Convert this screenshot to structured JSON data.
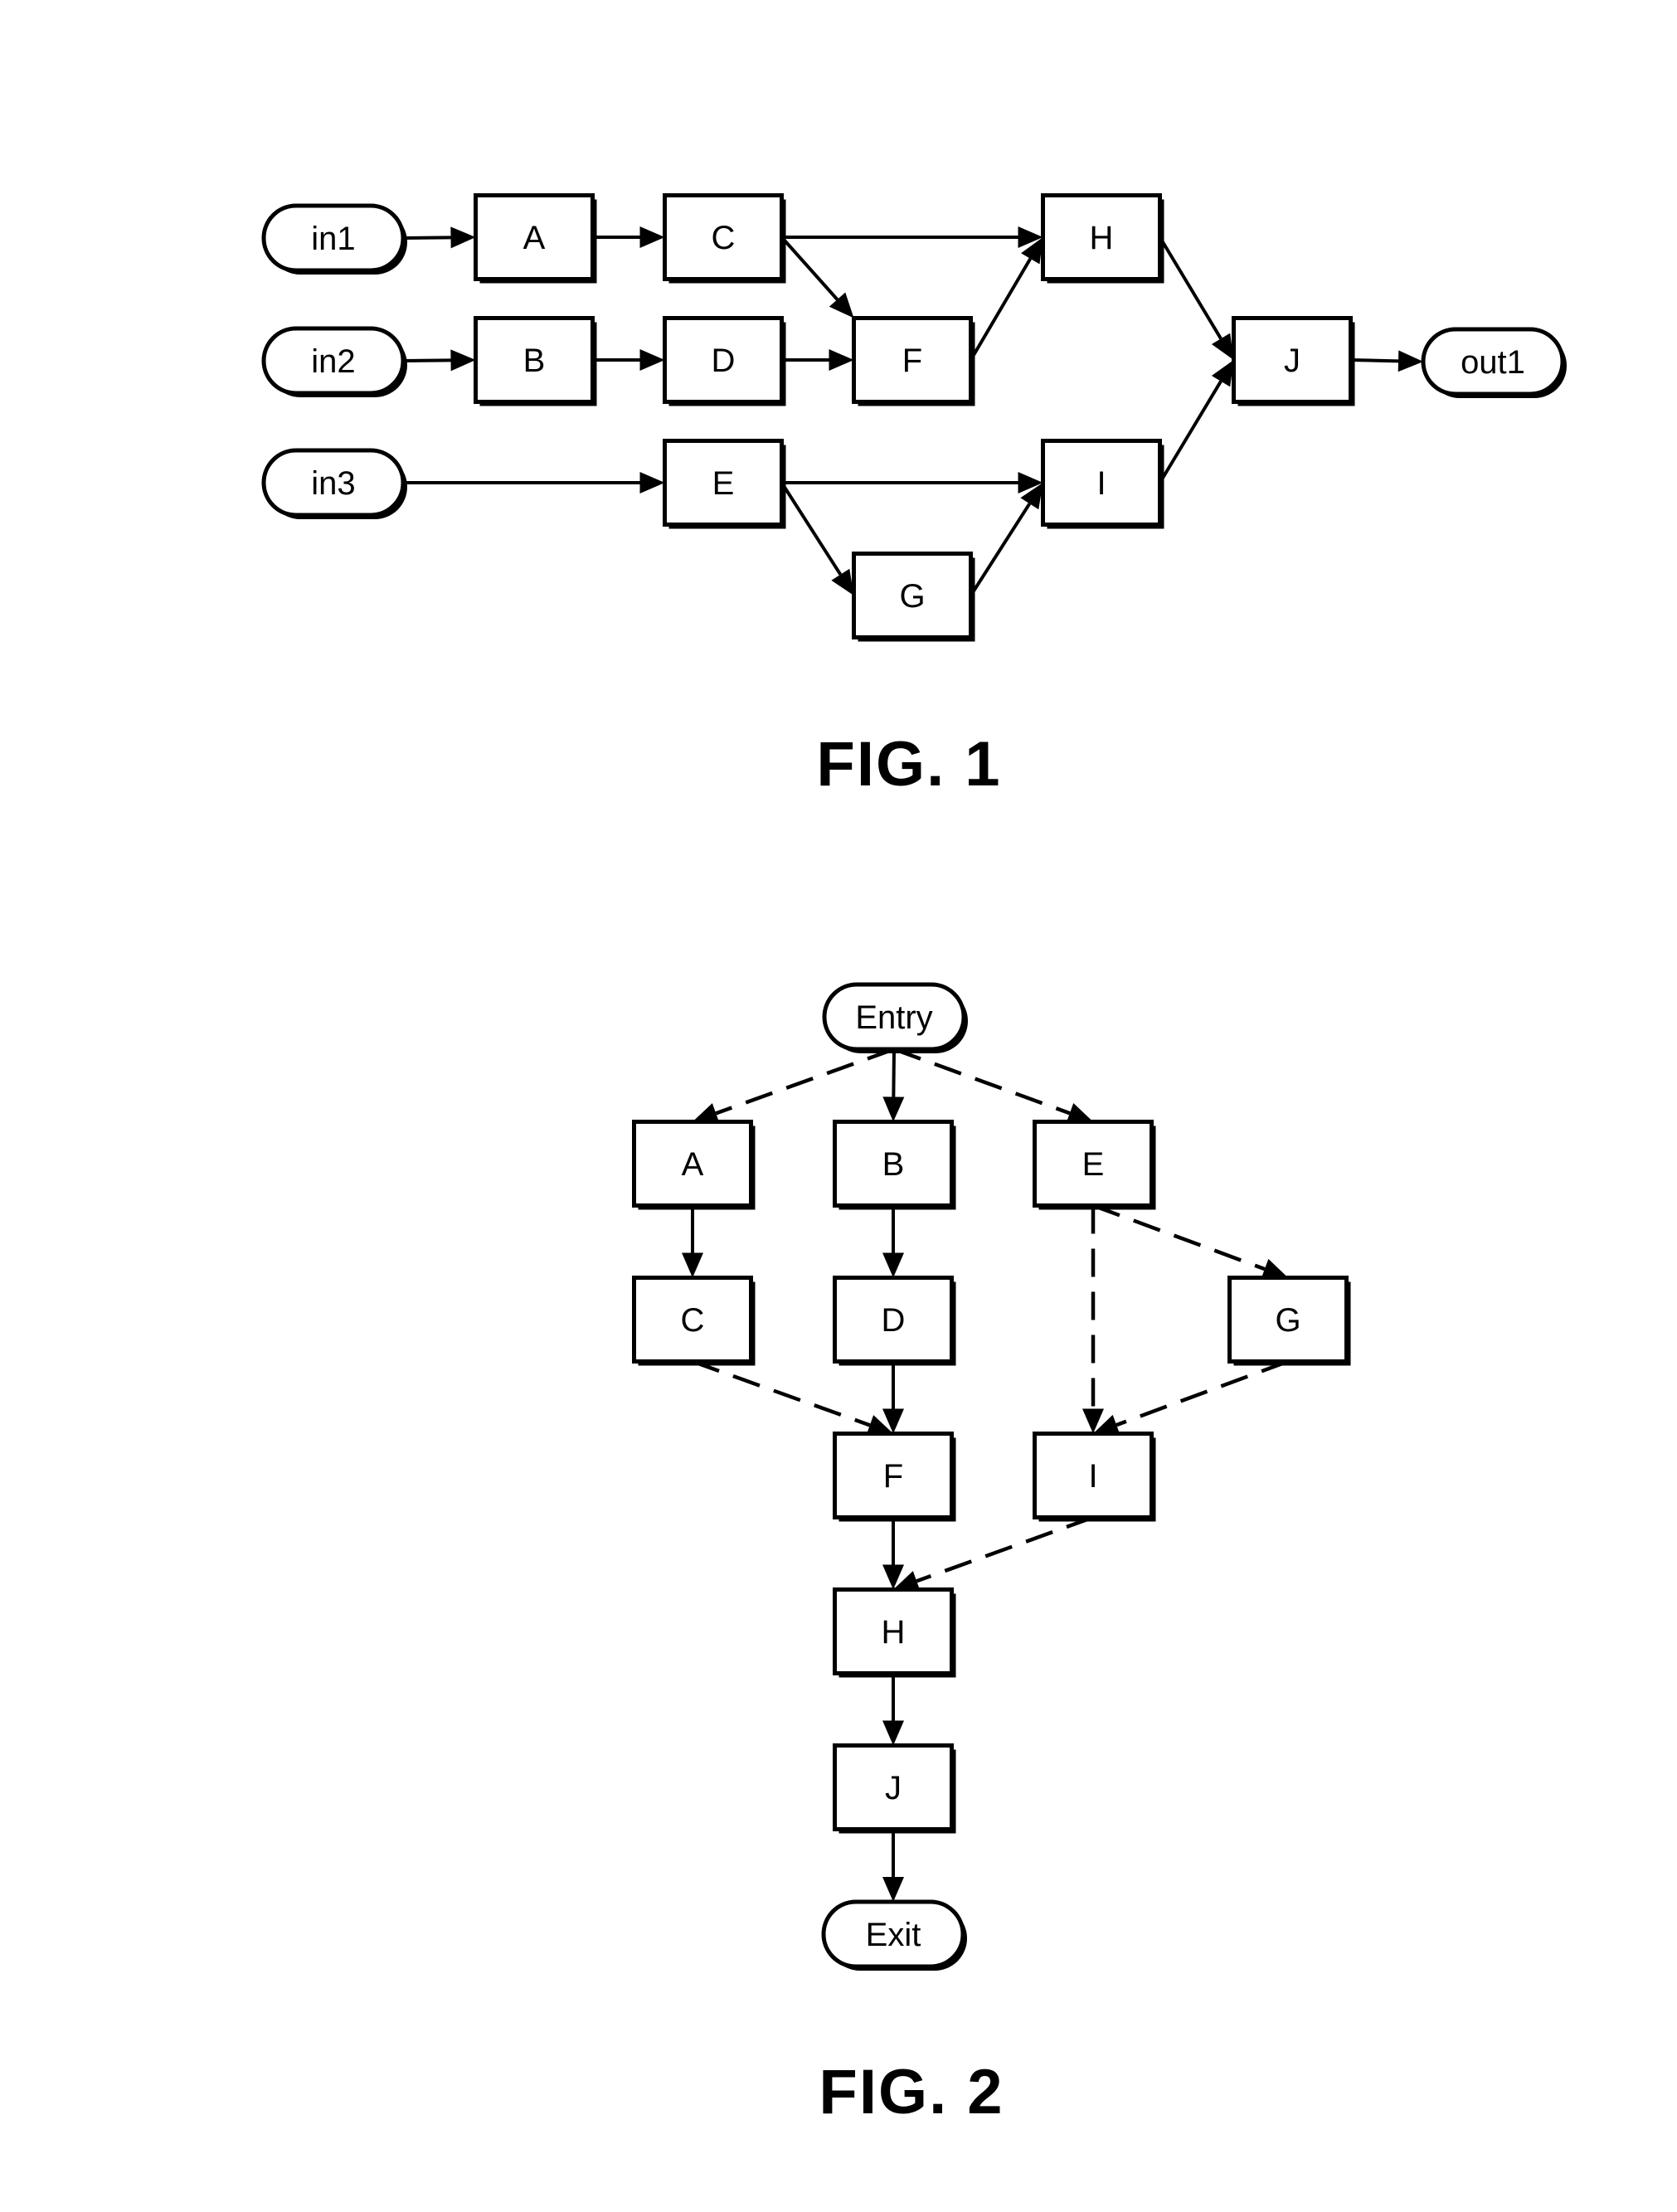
{
  "document": {
    "type": "patent-drawing-sheet",
    "background_color": "#ffffff",
    "ink_color": "#000000"
  },
  "figures": [
    {
      "id": "fig1",
      "caption": "FIG. 1",
      "description": "Block dataflow diagram",
      "nodes": [
        {
          "id": "in1",
          "label": "in1",
          "shape": "terminal"
        },
        {
          "id": "in2",
          "label": "in2",
          "shape": "terminal"
        },
        {
          "id": "in3",
          "label": "in3",
          "shape": "terminal"
        },
        {
          "id": "A",
          "label": "A",
          "shape": "block"
        },
        {
          "id": "B",
          "label": "B",
          "shape": "block"
        },
        {
          "id": "C",
          "label": "C",
          "shape": "block"
        },
        {
          "id": "D",
          "label": "D",
          "shape": "block"
        },
        {
          "id": "E",
          "label": "E",
          "shape": "block"
        },
        {
          "id": "F",
          "label": "F",
          "shape": "block"
        },
        {
          "id": "G",
          "label": "G",
          "shape": "block"
        },
        {
          "id": "H",
          "label": "H",
          "shape": "block"
        },
        {
          "id": "I",
          "label": "I",
          "shape": "block"
        },
        {
          "id": "J",
          "label": "J",
          "shape": "block"
        },
        {
          "id": "out1",
          "label": "out1",
          "shape": "terminal"
        }
      ],
      "edges": [
        {
          "from": "in1",
          "to": "A",
          "style": "solid"
        },
        {
          "from": "A",
          "to": "C",
          "style": "solid"
        },
        {
          "from": "C",
          "to": "H",
          "style": "solid"
        },
        {
          "from": "C",
          "to": "F",
          "style": "solid"
        },
        {
          "from": "in2",
          "to": "B",
          "style": "solid"
        },
        {
          "from": "B",
          "to": "D",
          "style": "solid"
        },
        {
          "from": "D",
          "to": "F",
          "style": "solid"
        },
        {
          "from": "F",
          "to": "H",
          "style": "solid"
        },
        {
          "from": "in3",
          "to": "E",
          "style": "solid"
        },
        {
          "from": "E",
          "to": "I",
          "style": "solid"
        },
        {
          "from": "E",
          "to": "G",
          "style": "solid"
        },
        {
          "from": "G",
          "to": "I",
          "style": "solid"
        },
        {
          "from": "H",
          "to": "J",
          "style": "solid"
        },
        {
          "from": "I",
          "to": "J",
          "style": "solid"
        },
        {
          "from": "J",
          "to": "out1",
          "style": "solid"
        }
      ]
    },
    {
      "id": "fig2",
      "caption": "FIG. 2",
      "description": "Control flow graph",
      "nodes": [
        {
          "id": "Entry",
          "label": "Entry",
          "shape": "terminal"
        },
        {
          "id": "A",
          "label": "A",
          "shape": "block"
        },
        {
          "id": "B",
          "label": "B",
          "shape": "block"
        },
        {
          "id": "E",
          "label": "E",
          "shape": "block"
        },
        {
          "id": "C",
          "label": "C",
          "shape": "block"
        },
        {
          "id": "D",
          "label": "D",
          "shape": "block"
        },
        {
          "id": "G",
          "label": "G",
          "shape": "block"
        },
        {
          "id": "F",
          "label": "F",
          "shape": "block"
        },
        {
          "id": "I",
          "label": "I",
          "shape": "block"
        },
        {
          "id": "H",
          "label": "H",
          "shape": "block"
        },
        {
          "id": "J",
          "label": "J",
          "shape": "block"
        },
        {
          "id": "Exit",
          "label": "Exit",
          "shape": "terminal"
        }
      ],
      "edges": [
        {
          "from": "Entry",
          "to": "A",
          "style": "dashed"
        },
        {
          "from": "Entry",
          "to": "B",
          "style": "solid"
        },
        {
          "from": "Entry",
          "to": "E",
          "style": "dashed"
        },
        {
          "from": "A",
          "to": "C",
          "style": "solid"
        },
        {
          "from": "B",
          "to": "D",
          "style": "solid"
        },
        {
          "from": "E",
          "to": "I",
          "style": "dashed"
        },
        {
          "from": "E",
          "to": "G",
          "style": "dashed"
        },
        {
          "from": "C",
          "to": "F",
          "style": "dashed"
        },
        {
          "from": "D",
          "to": "F",
          "style": "solid"
        },
        {
          "from": "G",
          "to": "I",
          "style": "dashed"
        },
        {
          "from": "F",
          "to": "H",
          "style": "solid"
        },
        {
          "from": "I",
          "to": "H",
          "style": "dashed"
        },
        {
          "from": "H",
          "to": "J",
          "style": "solid"
        },
        {
          "from": "J",
          "to": "Exit",
          "style": "solid"
        }
      ]
    }
  ]
}
